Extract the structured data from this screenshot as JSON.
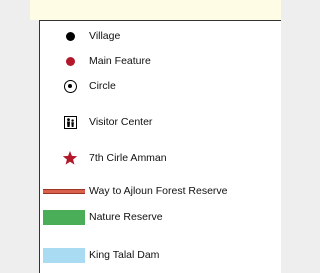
{
  "legend": {
    "items": [
      {
        "label": "Village",
        "symbol": "black-dot-icon",
        "color": "#000000"
      },
      {
        "label": "Main Feature",
        "symbol": "red-dot-icon",
        "color": "#b3182a"
      },
      {
        "label": "Circle",
        "symbol": "circle-target-icon",
        "color": "#000000"
      },
      {
        "label": "Visitor Center",
        "symbol": "visitor-center-icon",
        "color": "#000000"
      },
      {
        "label": "7th Cirle Amman",
        "symbol": "red-star-icon",
        "color": "#b3182a"
      },
      {
        "label": "Way to Ajloun Forest Reserve",
        "symbol": "road-line",
        "color": "#d9604a"
      },
      {
        "label": "Nature Reserve",
        "symbol": "green-area-swatch",
        "color": "#4aad57"
      },
      {
        "label": "King Talal Dam",
        "symbol": "water-area-swatch",
        "color": "#a9dbf2"
      }
    ]
  },
  "colors": {
    "background": "#eeeeee",
    "top_band": "#fffce6",
    "legend_border": "#333333"
  }
}
